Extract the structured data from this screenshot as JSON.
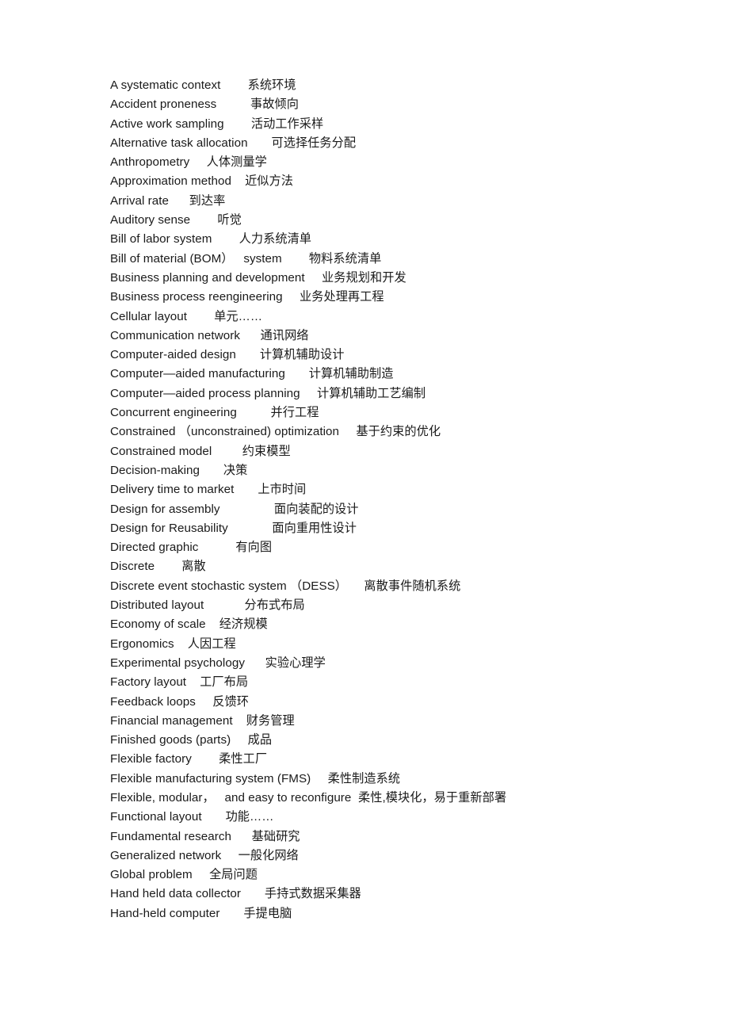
{
  "document": {
    "type": "bilingual-glossary",
    "language_pair": "English-Chinese",
    "page_background": "#ffffff",
    "text_color": "#1a1a1a",
    "entries": [
      {
        "term": "A systematic context",
        "gap": "        ",
        "translation": "系统环境"
      },
      {
        "term": "Accident proneness",
        "gap": "          ",
        "translation": "事故倾向"
      },
      {
        "term": "Active work sampling",
        "gap": "        ",
        "translation": "活动工作采样"
      },
      {
        "term": "Alternative task allocation",
        "gap": "       ",
        "translation": "可选择任务分配"
      },
      {
        "term": "Anthropometry",
        "gap": "     ",
        "translation": "人体测量学"
      },
      {
        "term": "Approximation method",
        "gap": "    ",
        "translation": "近似方法"
      },
      {
        "term": "Arrival rate",
        "gap": "      ",
        "translation": "到达率"
      },
      {
        "term": "Auditory sense",
        "gap": "        ",
        "translation": "听觉"
      },
      {
        "term": "Bill of labor system",
        "gap": "        ",
        "translation": "人力系统清单"
      },
      {
        "term": "Bill of material (BOM）   system",
        "gap": "        ",
        "translation": "物料系统清单"
      },
      {
        "term": "Business planning and development",
        "gap": "     ",
        "translation": "业务规划和开发"
      },
      {
        "term": "Business process reengineering",
        "gap": "     ",
        "translation": "业务处理再工程"
      },
      {
        "term": "Cellular layout",
        "gap": "        ",
        "translation": "单元……"
      },
      {
        "term": "Communication network",
        "gap": "      ",
        "translation": "通讯网络"
      },
      {
        "term": "Computer-aided design",
        "gap": "       ",
        "translation": "计算机辅助设计"
      },
      {
        "term": "Computer—aided manufacturing",
        "gap": "       ",
        "translation": "计算机辅助制造"
      },
      {
        "term": "Computer—aided process planning",
        "gap": "     ",
        "translation": "计算机辅助工艺编制"
      },
      {
        "term": "Concurrent engineering",
        "gap": "          ",
        "translation": "并行工程"
      },
      {
        "term": "Constrained （unconstrained) optimization",
        "gap": "     ",
        "translation": "基于约束的优化"
      },
      {
        "term": "Constrained model",
        "gap": "         ",
        "translation": "约束模型"
      },
      {
        "term": "Decision-making",
        "gap": "       ",
        "translation": "决策"
      },
      {
        "term": "Delivery time to market",
        "gap": "       ",
        "translation": "上市时间"
      },
      {
        "term": "Design for assembly",
        "gap": "                ",
        "translation": "面向装配的设计"
      },
      {
        "term": "Design for Reusability",
        "gap": "             ",
        "translation": "面向重用性设计"
      },
      {
        "term": "Directed graphic",
        "gap": "           ",
        "translation": "有向图"
      },
      {
        "term": "Discrete",
        "gap": "        ",
        "translation": "离散"
      },
      {
        "term": "Discrete event stochastic system （DESS）",
        "gap": "     ",
        "translation": "离散事件随机系统"
      },
      {
        "term": "Distributed layout",
        "gap": "            ",
        "translation": "分布式布局"
      },
      {
        "term": "Economy of scale",
        "gap": "    ",
        "translation": "经济规模"
      },
      {
        "term": "Ergonomics",
        "gap": "    ",
        "translation": "人因工程"
      },
      {
        "term": "Experimental psychology",
        "gap": "      ",
        "translation": "实验心理学"
      },
      {
        "term": "Factory layout",
        "gap": "    ",
        "translation": "工厂布局"
      },
      {
        "term": "Feedback loops",
        "gap": "     ",
        "translation": "反馈环"
      },
      {
        "term": "Financial management",
        "gap": "    ",
        "translation": "财务管理"
      },
      {
        "term": "Finished goods (parts)",
        "gap": "     ",
        "translation": "成品"
      },
      {
        "term": "Flexible factory",
        "gap": "        ",
        "translation": "柔性工厂"
      },
      {
        "term": "Flexible manufacturing system (FMS)",
        "gap": "     ",
        "translation": "柔性制造系统"
      },
      {
        "term": "Flexible, modular，   and easy to reconfigure",
        "gap": "  ",
        "translation": "柔性,模块化，易于重新部署"
      },
      {
        "term": "Functional layout",
        "gap": "       ",
        "translation": "功能……"
      },
      {
        "term": "Fundamental research",
        "gap": "      ",
        "translation": "基础研究"
      },
      {
        "term": "Generalized network",
        "gap": "     ",
        "translation": "一般化网络"
      },
      {
        "term": "Global problem",
        "gap": "     ",
        "translation": "全局问题"
      },
      {
        "term": "Hand held data collector",
        "gap": "       ",
        "translation": "手持式数据采集器"
      },
      {
        "term": "Hand-held computer",
        "gap": "       ",
        "translation": "手提电脑"
      }
    ]
  }
}
